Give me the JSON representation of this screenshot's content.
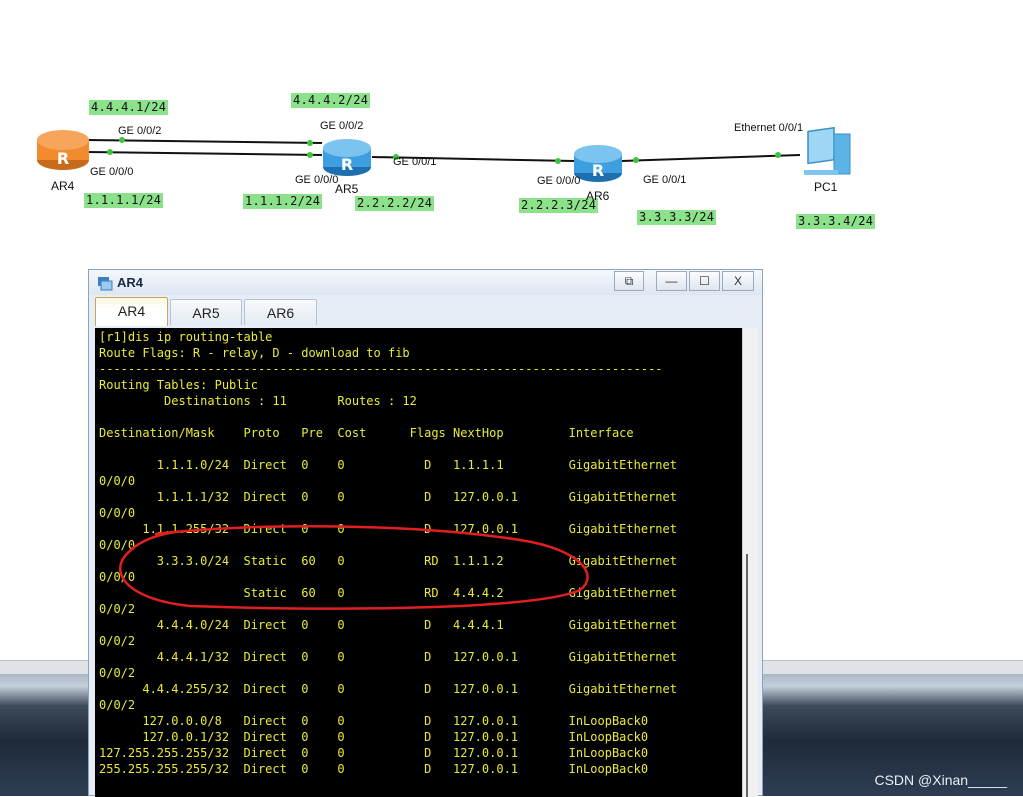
{
  "topology": {
    "devices": [
      {
        "name": "AR4"
      },
      {
        "name": "AR5"
      },
      {
        "name": "AR6"
      },
      {
        "name": "PC1"
      }
    ],
    "ports": {
      "ar4_g2": "GE 0/0/2",
      "ar4_g0": "GE 0/0/0",
      "ar5_g2": "GE 0/0/2",
      "ar5_g0": "GE 0/0/0",
      "ar5_g1": "GE 0/0/1",
      "ar6_g0": "GE 0/0/0",
      "ar6_g1": "GE 0/0/1",
      "pc1_eth": "Ethernet 0/0/1"
    },
    "ips": {
      "ar4_g2": "4.4.4.1/24",
      "ar4_g0": "1.1.1.1/24",
      "ar5_g2": "4.4.4.2/24",
      "ar5_g0": "1.1.1.2/24",
      "ar5_g1": "2.2.2.2/24",
      "ar6_g0": "2.2.2.3/24",
      "ar6_g1": "3.3.3.3/24",
      "pc1": "3.3.3.4/24"
    }
  },
  "window": {
    "title": "AR4",
    "controls": {
      "restore": "⧉",
      "minimize": "—",
      "maximize": "☐",
      "close": "X"
    },
    "tabs": [
      {
        "label": "AR4",
        "active": true
      },
      {
        "label": "AR5",
        "active": false
      },
      {
        "label": "AR6",
        "active": false
      }
    ]
  },
  "terminal": {
    "lines": [
      "[r1]dis ip routing-table",
      "Route Flags: R - relay, D - download to fib",
      "------------------------------------------------------------------------------",
      "Routing Tables: Public",
      "         Destinations : 11       Routes : 12",
      "",
      "Destination/Mask    Proto   Pre  Cost      Flags NextHop         Interface",
      "",
      "        1.1.1.0/24  Direct  0    0           D   1.1.1.1         GigabitEthernet",
      "0/0/0",
      "        1.1.1.1/32  Direct  0    0           D   127.0.0.1       GigabitEthernet",
      "0/0/0",
      "      1.1.1.255/32  Direct  0    0           D   127.0.0.1       GigabitEthernet",
      "0/0/0",
      "        3.3.3.0/24  Static  60   0           RD  1.1.1.2         GigabitEthernet",
      "0/0/0",
      "                    Static  60   0           RD  4.4.4.2         GigabitEthernet",
      "0/0/2",
      "        4.4.4.0/24  Direct  0    0           D   4.4.4.1         GigabitEthernet",
      "0/0/2",
      "        4.4.4.1/32  Direct  0    0           D   127.0.0.1       GigabitEthernet",
      "0/0/2",
      "      4.4.4.255/32  Direct  0    0           D   127.0.0.1       GigabitEthernet",
      "0/0/2",
      "      127.0.0.0/8   Direct  0    0           D   127.0.0.1       InLoopBack0",
      "      127.0.0.1/32  Direct  0    0           D   127.0.0.1       InLoopBack0",
      "127.255.255.255/32  Direct  0    0           D   127.0.0.1       InLoopBack0",
      "255.255.255.255/32  Direct  0    0           D   127.0.0.1       InLoopBack0"
    ]
  },
  "watermark": "CSDN @Xinan_____",
  "colors": {
    "ip_label_bg": "#8be28b",
    "router_orange": "#f28a2e",
    "router_blue": "#3d9fe0",
    "terminal_text": "#eaea3b",
    "annotation_red": "#e02020"
  }
}
